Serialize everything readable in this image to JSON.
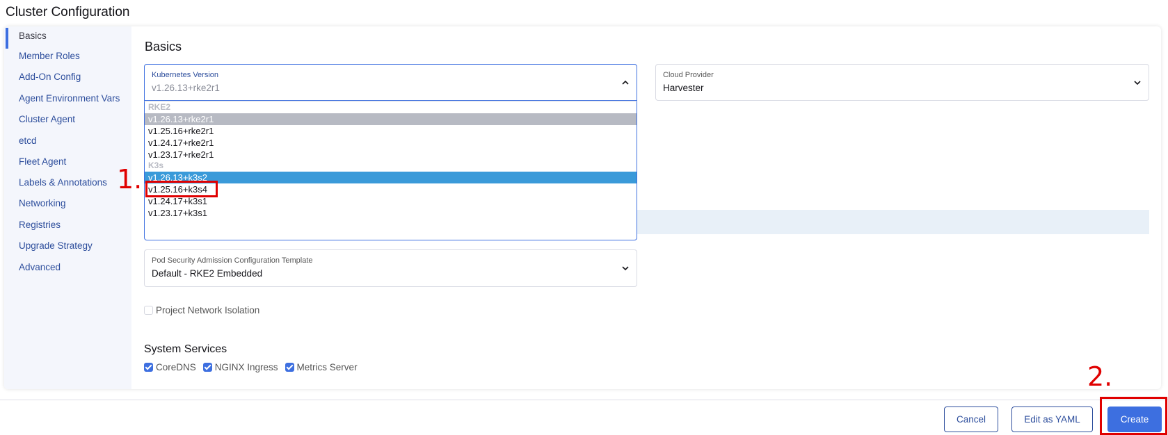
{
  "page_title": "Cluster Configuration",
  "sidebar": {
    "items": [
      {
        "label": "Basics"
      },
      {
        "label": "Member Roles"
      },
      {
        "label": "Add-On Config"
      },
      {
        "label": "Agent Environment Vars"
      },
      {
        "label": "Cluster Agent"
      },
      {
        "label": "etcd"
      },
      {
        "label": "Fleet Agent"
      },
      {
        "label": "Labels & Annotations"
      },
      {
        "label": "Networking"
      },
      {
        "label": "Registries"
      },
      {
        "label": "Upgrade Strategy"
      },
      {
        "label": "Advanced"
      }
    ]
  },
  "main": {
    "section_title": "Basics",
    "kubernetes_version": {
      "label": "Kubernetes Version",
      "value": "v1.26.13+rke2r1",
      "dropdown": {
        "groups": [
          {
            "label": "RKE2",
            "options": [
              "v1.26.13+rke2r1",
              "v1.25.16+rke2r1",
              "v1.24.17+rke2r1",
              "v1.23.17+rke2r1"
            ]
          },
          {
            "label": "K3s",
            "options": [
              "v1.26.13+k3s2",
              "v1.25.16+k3s4",
              "v1.24.17+k3s1",
              "v1.23.17+k3s1"
            ]
          }
        ],
        "hovered_option": "v1.26.13+rke2r1",
        "highlighted_option": "v1.26.13+k3s2"
      }
    },
    "cloud_provider": {
      "label": "Cloud Provider",
      "value": "Harvester"
    },
    "psa_template": {
      "label": "Pod Security Admission Configuration Template",
      "value": "Default - RKE2 Embedded"
    },
    "project_network_isolation": {
      "label": "Project Network Isolation",
      "checked": false
    },
    "system_services": {
      "title": "System Services",
      "items": [
        {
          "label": "CoreDNS",
          "checked": true
        },
        {
          "label": "NGINX Ingress",
          "checked": true
        },
        {
          "label": "Metrics Server",
          "checked": true
        }
      ]
    }
  },
  "footer": {
    "cancel_label": "Cancel",
    "edit_yaml_label": "Edit as YAML",
    "create_label": "Create"
  },
  "annotations": {
    "step1": "1.",
    "step2": "2."
  },
  "colors": {
    "accent": "#3d6fe0",
    "link": "#2c4d9c",
    "annotation": "#e00000",
    "option_highlight": "#3a9ad9"
  }
}
